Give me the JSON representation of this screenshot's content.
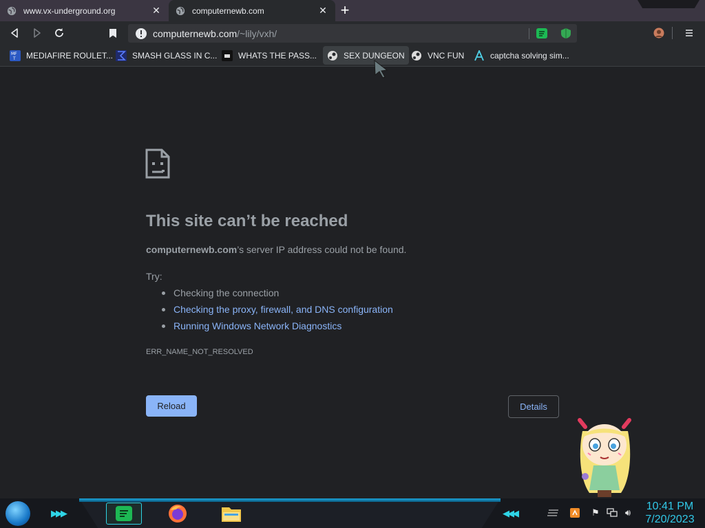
{
  "tabs": [
    {
      "title": "www.vx-underground.org",
      "active": false
    },
    {
      "title": "computernewb.com",
      "active": true
    }
  ],
  "toolbar": {
    "url_host": "computernewb.com",
    "url_path": "/~lily/vxh/"
  },
  "bookmarks": [
    {
      "label": "MEDIAFIRE ROULET...",
      "icon": "mediafire-icon"
    },
    {
      "label": "SMASH GLASS IN C...",
      "icon": "sigma-icon"
    },
    {
      "label": "WHATS THE PASS...",
      "icon": "dark-square-icon"
    },
    {
      "label": "SEX DUNGEON",
      "icon": "steam-icon"
    },
    {
      "label": "VNC FUN",
      "icon": "steam-icon"
    },
    {
      "label": "captcha solving sim...",
      "icon": "lambda-icon"
    }
  ],
  "error": {
    "title": "This site can’t be reached",
    "host": "computernewb.com",
    "desc_rest": "’s server IP address could not be found.",
    "try_label": "Try:",
    "suggestions": [
      "Checking the connection",
      "Checking the proxy, firewall, and DNS configuration",
      "Running Windows Network Diagnostics"
    ],
    "code": "ERR_NAME_NOT_RESOLVED",
    "reload_label": "Reload",
    "details_label": "Details"
  },
  "taskbar": {
    "time": "10:41 PM",
    "date": "7/20/2023",
    "apps": [
      "spotify-icon",
      "firefox-icon",
      "file-explorer-icon"
    ]
  },
  "colors": {
    "page_bg": "#202124",
    "link": "#8ab4f8",
    "clock": "#31c9e8"
  }
}
